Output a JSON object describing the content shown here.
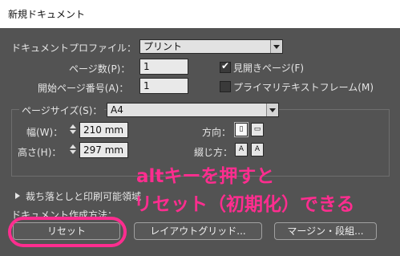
{
  "window": {
    "title": "新規ドキュメント"
  },
  "profile": {
    "label": "ドキュメントプロファイル：",
    "value": "プリント"
  },
  "pages": {
    "label": "ページ数(P)：",
    "value": "1"
  },
  "start_page": {
    "label": "開始ページ番号(A)：",
    "value": "1"
  },
  "facing_pages": {
    "label": "見開きページ(F)",
    "checked": true
  },
  "primary_text_frame": {
    "label": "プライマリテキストフレーム(M)",
    "checked": false
  },
  "page_size": {
    "label": "ページサイズ(S)：",
    "value": "A4",
    "width_label": "幅(W)：",
    "width_value": "210 mm",
    "height_label": "高さ(H)：",
    "height_value": "297 mm",
    "orientation_label": "方向：",
    "binding_label": "綴じ方："
  },
  "bleed_section": {
    "label": "裁ち落としと印刷可能領域"
  },
  "creation_method": {
    "label": "ドキュメント作成方法："
  },
  "buttons": {
    "reset": "リセット",
    "layout_grid": "レイアウトグリッド...",
    "margin_columns": "マージン・段組..."
  },
  "annotation": {
    "line1": "altキーを押すと",
    "line2": "リセット（初期化）できる",
    "color": "#ff2d8f"
  },
  "colors": {
    "dialog_bg": "#535353",
    "field_bg": "#e9e9e9"
  }
}
